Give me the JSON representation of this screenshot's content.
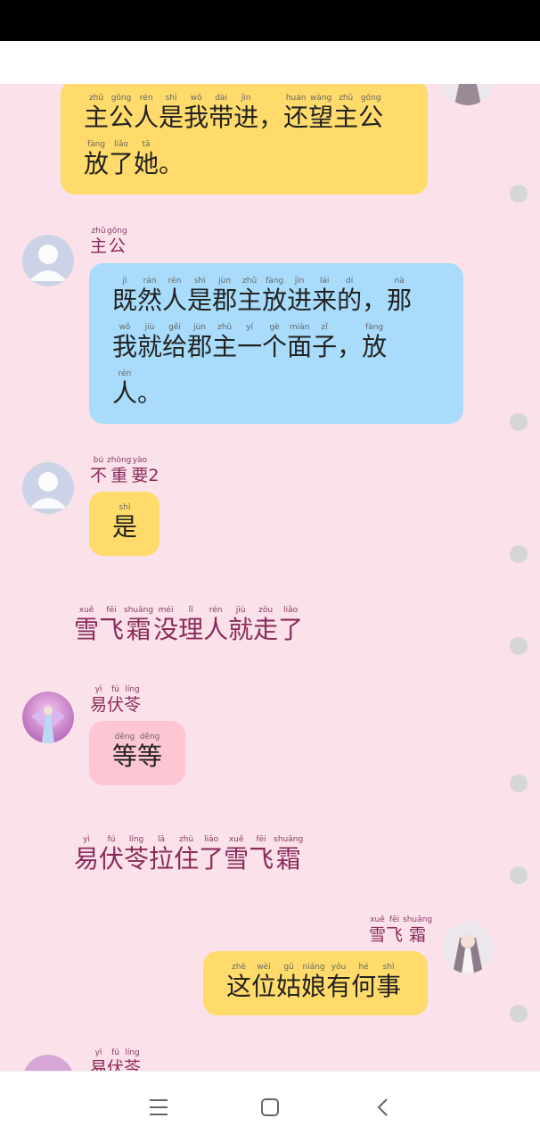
{
  "messages": {
    "m1": {
      "line1": [
        [
          "zhǔ",
          "主"
        ],
        [
          "gōng",
          "公"
        ],
        [
          "rén",
          "人"
        ],
        [
          "shì",
          "是"
        ],
        [
          "wǒ",
          "我"
        ],
        [
          "dài",
          "带"
        ],
        [
          "jìn",
          "进"
        ],
        [
          "",
          "，"
        ],
        [
          "huán",
          "还"
        ],
        [
          "wàng",
          "望"
        ],
        [
          "zhǔ",
          "主"
        ],
        [
          "gōng",
          "公"
        ]
      ],
      "line2": [
        [
          "fàng",
          "放"
        ],
        [
          "liǎo",
          "了"
        ],
        [
          "tā",
          "她"
        ],
        [
          "",
          "。"
        ]
      ]
    },
    "m2": {
      "sender": [
        [
          "zhǔ",
          "主"
        ],
        [
          "gōng",
          "公"
        ]
      ],
      "line1": [
        [
          "jì",
          "既"
        ],
        [
          "rán",
          "然"
        ],
        [
          "rén",
          "人"
        ],
        [
          "shì",
          "是"
        ],
        [
          "jùn",
          "郡"
        ],
        [
          "zhǔ",
          "主"
        ],
        [
          "fàng",
          "放"
        ],
        [
          "jìn",
          "进"
        ],
        [
          "lái",
          "来"
        ],
        [
          "dí",
          "的"
        ],
        [
          "",
          "，"
        ],
        [
          "nà",
          "那"
        ]
      ],
      "line2": [
        [
          "wǒ",
          "我"
        ],
        [
          "jiù",
          "就"
        ],
        [
          "gěi",
          "给"
        ],
        [
          "jùn",
          "郡"
        ],
        [
          "zhǔ",
          "主"
        ],
        [
          "yí",
          "一"
        ],
        [
          "gè",
          "个"
        ],
        [
          "miàn",
          "面"
        ],
        [
          "zǐ",
          "子"
        ],
        [
          "",
          "，"
        ],
        [
          "fàng",
          "放"
        ]
      ],
      "line3": [
        [
          "rén",
          "人"
        ],
        [
          "",
          "。"
        ]
      ]
    },
    "m3": {
      "sender": [
        [
          "bú",
          "不"
        ],
        [
          "zhòng",
          "重"
        ],
        [
          "yào",
          "要"
        ],
        [
          "",
          "2"
        ]
      ],
      "line1": [
        [
          "shì",
          "是"
        ]
      ]
    },
    "n1": [
      [
        "xuě",
        "雪"
      ],
      [
        "fēi",
        "飞"
      ],
      [
        "shuāng",
        "霜"
      ],
      [
        "méi",
        "没"
      ],
      [
        "lǐ",
        "理"
      ],
      [
        "rén",
        "人"
      ],
      [
        "jiù",
        "就"
      ],
      [
        "zǒu",
        "走"
      ],
      [
        "liǎo",
        "了"
      ]
    ],
    "m4": {
      "sender": [
        [
          "yì",
          "易"
        ],
        [
          "fú",
          "伏"
        ],
        [
          "líng",
          "苓"
        ]
      ],
      "line1": [
        [
          "děng",
          "等"
        ],
        [
          "děng",
          "等"
        ]
      ]
    },
    "n2": [
      [
        "yì",
        "易"
      ],
      [
        "fú",
        "伏"
      ],
      [
        "líng",
        "苓"
      ],
      [
        "lā",
        "拉"
      ],
      [
        "zhù",
        "住"
      ],
      [
        "liǎo",
        "了"
      ],
      [
        "xuě",
        "雪"
      ],
      [
        "fēi",
        "飞"
      ],
      [
        "shuāng",
        "霜"
      ]
    ],
    "m5": {
      "sender": [
        [
          "xuě",
          "雪"
        ],
        [
          "fēi",
          "飞"
        ],
        [
          "shuāng",
          "霜"
        ]
      ],
      "line1": [
        [
          "zhè",
          "这"
        ],
        [
          "wèi",
          "位"
        ],
        [
          "gū",
          "姑"
        ],
        [
          "niáng",
          "娘"
        ],
        [
          "yǒu",
          "有"
        ],
        [
          "hé",
          "何"
        ],
        [
          "shì",
          "事"
        ]
      ]
    },
    "m6": {
      "sender": [
        [
          "yì",
          "易"
        ],
        [
          "fú",
          "伏"
        ],
        [
          "líng",
          "苓"
        ]
      ]
    }
  },
  "icons": {
    "nav_menu": "menu-icon",
    "nav_home": "home-square-icon",
    "nav_back": "back-chevron-icon"
  },
  "colors": {
    "background": "#fbe1ea",
    "yellow_bubble": "#fedb6a",
    "blue_bubble": "#a8dcfa",
    "pink_bubble": "#fec6d2",
    "name_text": "#8a2a5a"
  }
}
